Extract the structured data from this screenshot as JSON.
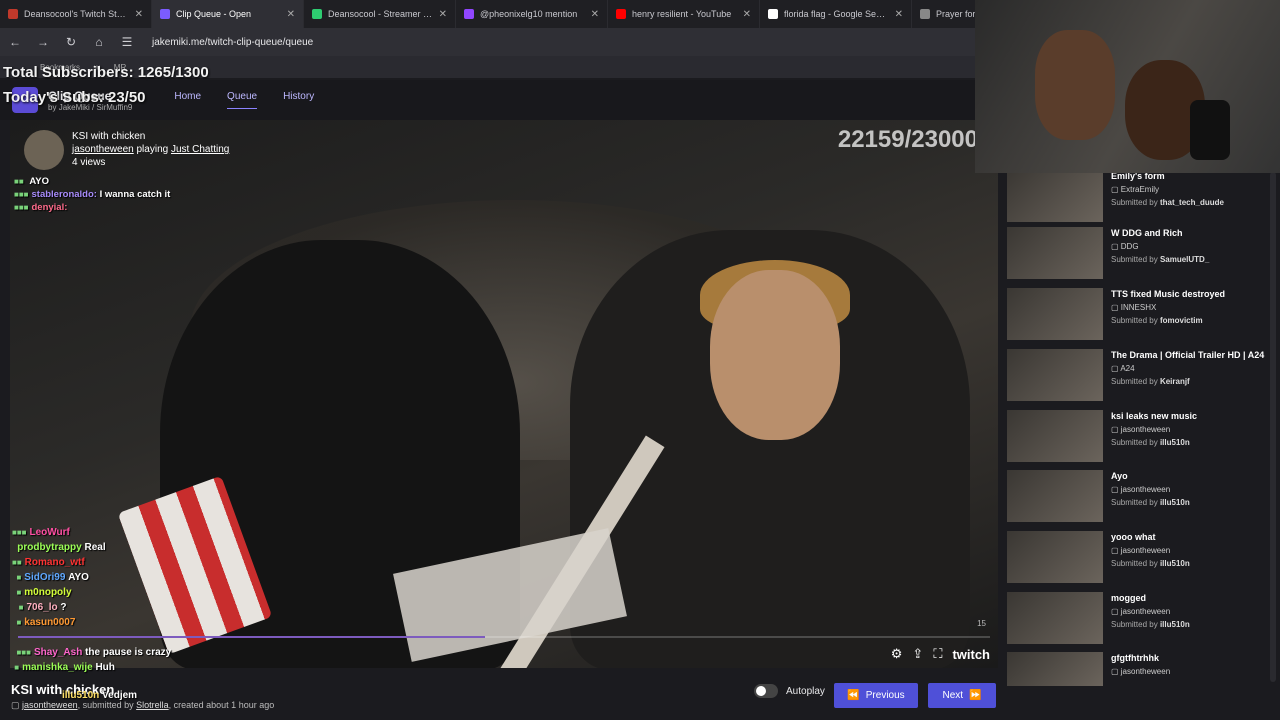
{
  "browser": {
    "tabs": [
      {
        "title": "Deansocool's Twitch Statistic",
        "color": "#c0392b"
      },
      {
        "title": "Clip Queue - Open",
        "color": "#7b5cff",
        "active": true
      },
      {
        "title": "Deansocool - Streamer Over",
        "color": "#2ecc71"
      },
      {
        "title": "@pheonixelg10 mention",
        "color": "#9146ff"
      },
      {
        "title": "henry resilient - YouTube",
        "color": "#ff0000"
      },
      {
        "title": "florida flag - Google Search",
        "color": "#ffffff"
      },
      {
        "title": "Prayer for Lu",
        "color": "#888888"
      }
    ],
    "close_glyph": "✕",
    "url": "jakemiki.me/twitch-clip-queue/queue",
    "bookmarks": [
      "Bookmarks",
      "w",
      "MR"
    ]
  },
  "overlay": {
    "total_subs": "Total Subscribers: 1265/1300",
    "today_subs": "Today's Subs: 23/50"
  },
  "app": {
    "title": "Clip Queue",
    "byline_prefix": "by",
    "author1": "JakeMiki",
    "author2": "SirMuffin9",
    "nav": [
      "Home",
      "Queue",
      "History"
    ]
  },
  "video": {
    "counter": "22159/23000",
    "clip_title": "KSI with chicken",
    "channel": "jasontheween",
    "playing_word": "playing",
    "game": "Just Chatting",
    "views": "4 views",
    "vnum": "15",
    "twitch_label": "twitch"
  },
  "chat_top": [
    {
      "name": "",
      "msg": "AYO",
      "color": "#8fb3ff"
    },
    {
      "name": "stableronaldo:",
      "msg": "I wanna catch it",
      "color": "#a78bfa"
    },
    {
      "name": "denyial:",
      "msg": "",
      "color": "#ff6b8b"
    }
  ],
  "chat_bottom": [
    {
      "name": "LeoWurf",
      "msg": "",
      "color": "#ff4fa3"
    },
    {
      "name": "prodbytrappy",
      "msg": "Real",
      "color": "#9cff57"
    },
    {
      "name": "Romano_wtf",
      "msg": "",
      "color": "#ff3333"
    },
    {
      "name": "SidOri99",
      "msg": "AYO",
      "color": "#5fa8ff"
    },
    {
      "name": "m0nopoly",
      "msg": "",
      "color": "#d4ff3a"
    },
    {
      "name": "706_lo",
      "msg": "?",
      "color": "#ffb0c0"
    },
    {
      "name": "kasun0007",
      "msg": "",
      "color": "#ff9933"
    },
    {
      "name": "Shay_Ash",
      "msg": "the pause is crazy",
      "color": "#ff66cc"
    },
    {
      "name": "manishka_wije",
      "msg": "Huh",
      "color": "#9cff57"
    },
    {
      "name": "illu510n",
      "msg": "Vedjem",
      "color": "#ffe066"
    }
  ],
  "below": {
    "title": "KSI with chicken",
    "channel": "jasontheween",
    "submitted_by_label": ", submitted by",
    "submitter": "Slotrella",
    "created": ", created about 1 hour ago",
    "autoplay": "Autoplay",
    "prev": "Previous",
    "next": "Next"
  },
  "queue": [
    {
      "title": "Emily's form",
      "channel": "ExtraEmily",
      "submitted_by": "that_tech_duude"
    },
    {
      "title": "W DDG and Rich",
      "channel": "DDG",
      "submitted_by": "SamuelUTD_"
    },
    {
      "title": "TTS fixed Music destroyed",
      "channel": "INNESHX",
      "submitted_by": "fomovictim"
    },
    {
      "title": "The Drama | Official Trailer HD | A24",
      "channel": "A24",
      "submitted_by": "Keiranjf"
    },
    {
      "title": "ksi leaks new music",
      "channel": "jasontheween",
      "submitted_by": "illu510n"
    },
    {
      "title": "Ayo",
      "channel": "jasontheween",
      "submitted_by": "illu510n"
    },
    {
      "title": "yooo what",
      "channel": "jasontheween",
      "submitted_by": "illu510n"
    },
    {
      "title": "mogged",
      "channel": "jasontheween",
      "submitted_by": "illu510n"
    },
    {
      "title": "gfgtfhtrhhk",
      "channel": "jasontheween",
      "submitted_by": ""
    }
  ],
  "submitted_by_label": "Submitted by"
}
